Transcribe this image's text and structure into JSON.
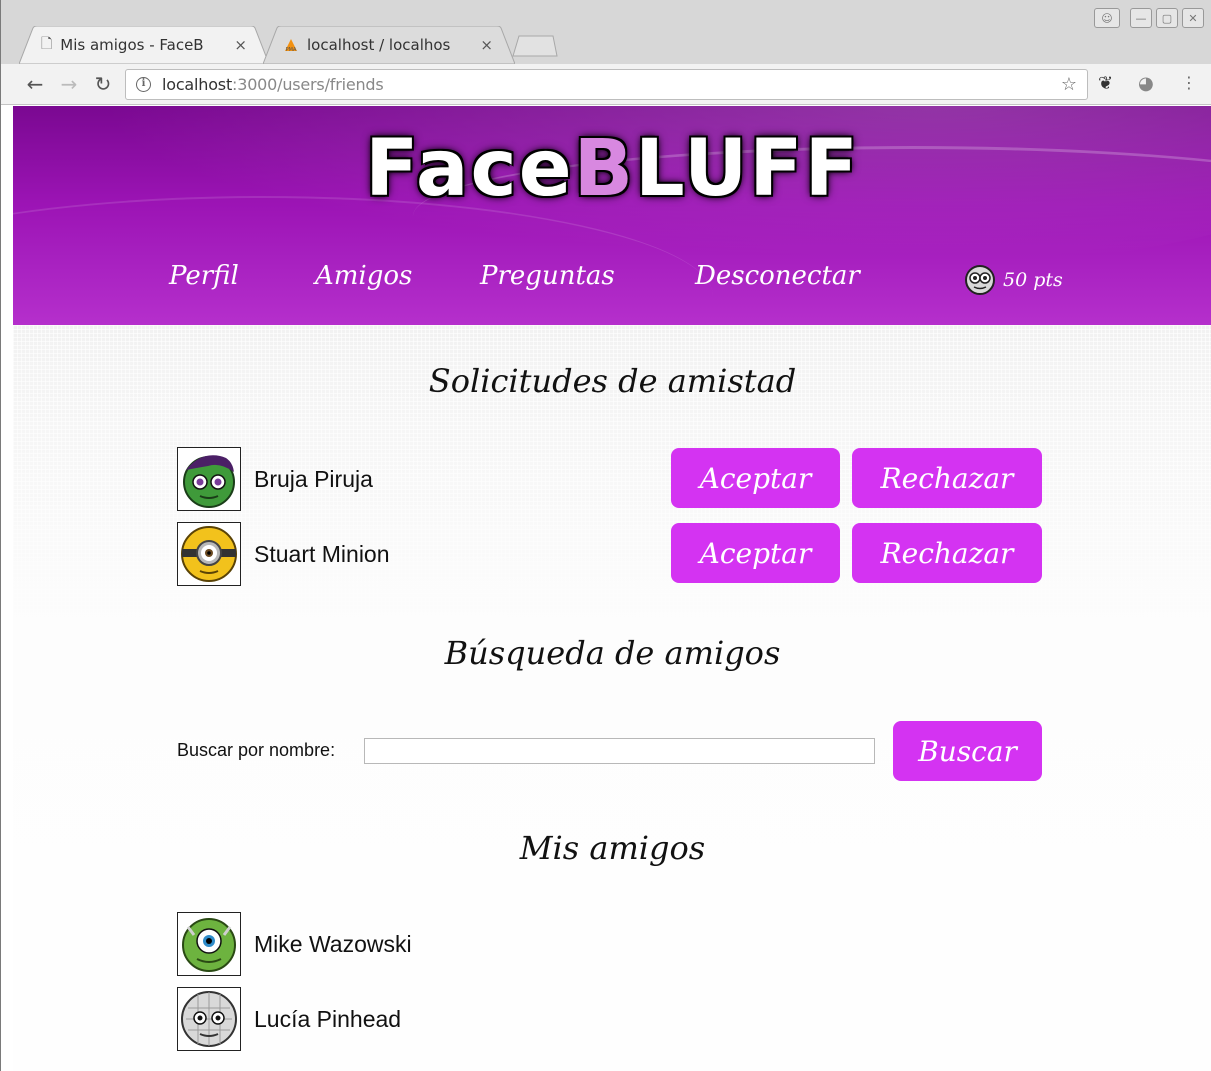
{
  "browser": {
    "tabs": [
      {
        "title": "Mis amigos - FaceB",
        "active": true
      },
      {
        "title": "localhost / localhos",
        "active": false
      }
    ],
    "close_glyph": "×",
    "url_host": "localhost",
    "url_path": ":3000/users/friends"
  },
  "header": {
    "logo_part1": "Face",
    "logo_accent": "B",
    "logo_part2": "LUFF",
    "nav": [
      "Perfil",
      "Amigos",
      "Preguntas",
      "Desconectar"
    ],
    "points": "50 pts"
  },
  "requests": {
    "title": "Solicitudes de amistad",
    "items": [
      {
        "name": "Bruja Piruja",
        "avatar": "witch-avatar-icon",
        "accept": "Aceptar",
        "reject": "Rechazar"
      },
      {
        "name": "Stuart Minion",
        "avatar": "minion-avatar-icon",
        "accept": "Aceptar",
        "reject": "Rechazar"
      }
    ]
  },
  "search": {
    "title": "Búsqueda de amigos",
    "label": "Buscar por nombre:",
    "value": "",
    "button": "Buscar"
  },
  "friends": {
    "title": "Mis amigos",
    "items": [
      {
        "name": "Mike Wazowski",
        "avatar": "mike-avatar-icon"
      },
      {
        "name": "Lucía Pinhead",
        "avatar": "pinhead-avatar-icon"
      }
    ]
  },
  "colors": {
    "header_purple": "#9c14b5",
    "button_magenta": "#d433f2"
  }
}
